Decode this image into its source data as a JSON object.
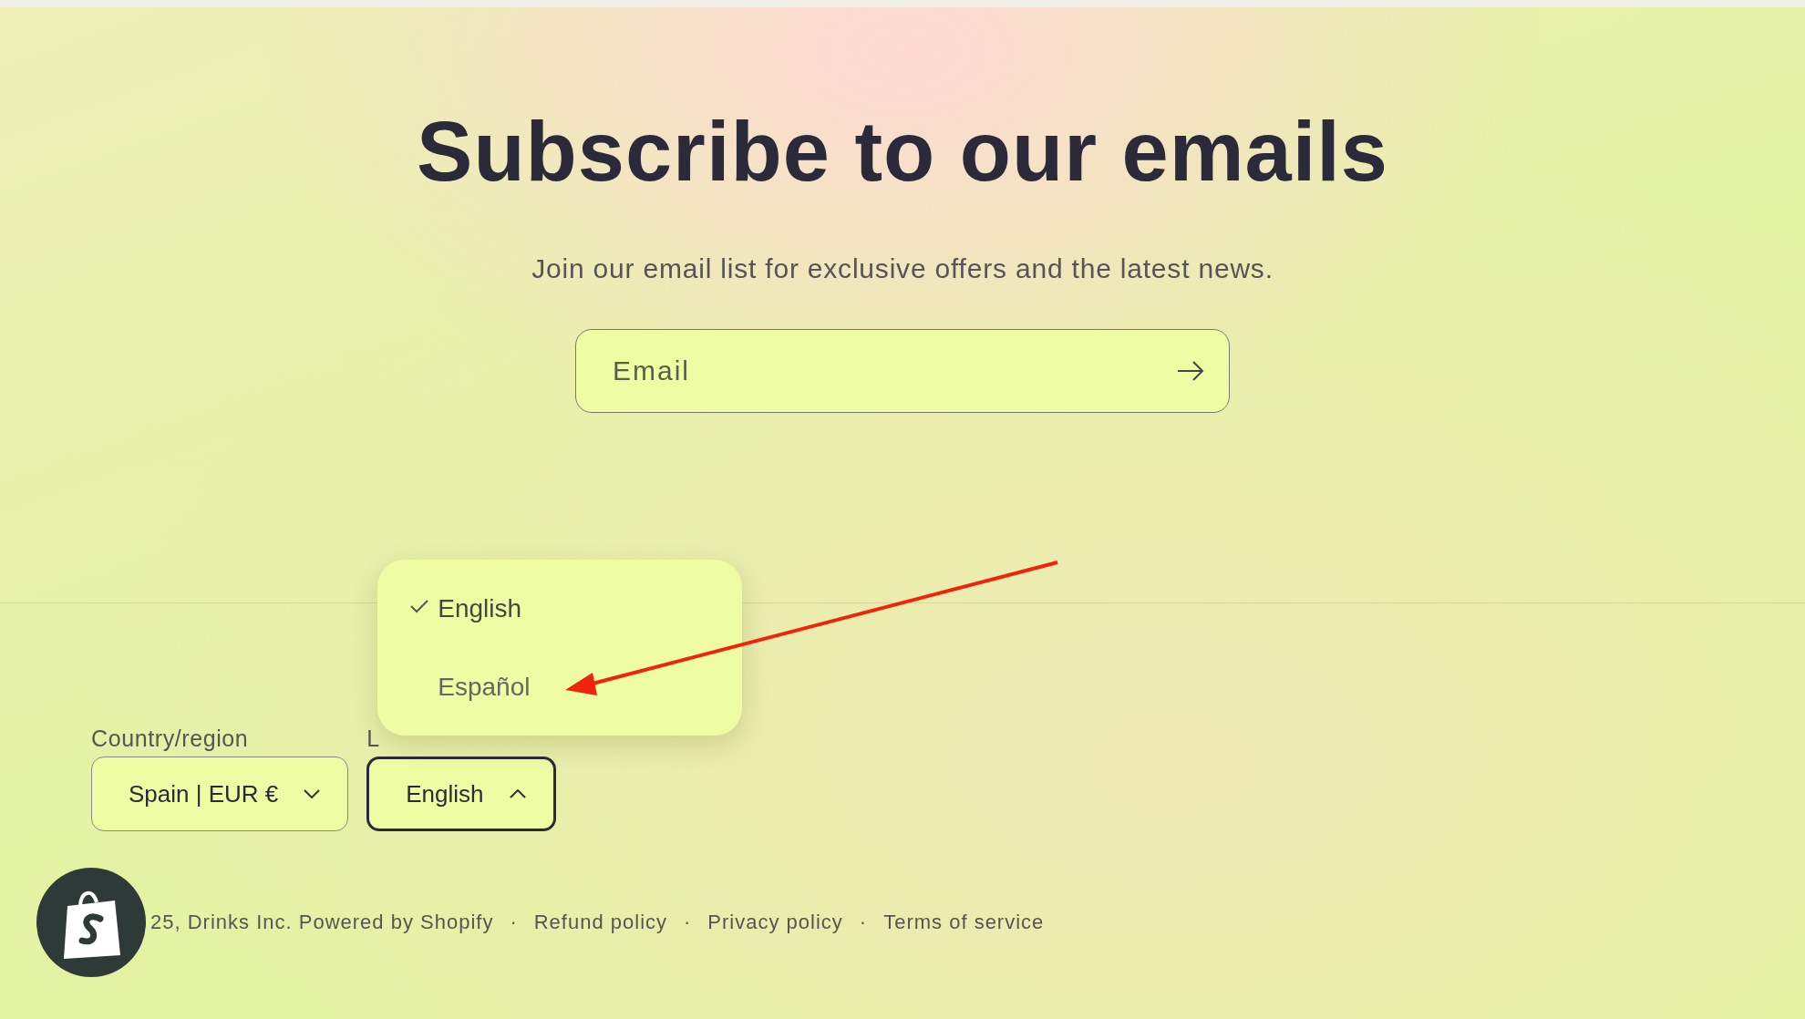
{
  "heading": "Subscribe to our emails",
  "subtitle": "Join our email list for exclusive offers and the latest news.",
  "email": {
    "placeholder": "Email"
  },
  "localization": [
    {
      "label": "Country/region",
      "value": "Spain | EUR €",
      "expanded": false
    },
    {
      "label": "L",
      "value": "English",
      "expanded": true,
      "options": [
        {
          "label": "English",
          "selected": true
        },
        {
          "label": "Español",
          "selected": false
        }
      ]
    }
  ],
  "footer": {
    "copyright": "25, Drinks Inc. Powered by Shopify",
    "separators": [
      "·",
      "·",
      "·"
    ],
    "links": [
      "Refund policy",
      "Privacy policy",
      "Terms of service"
    ]
  }
}
